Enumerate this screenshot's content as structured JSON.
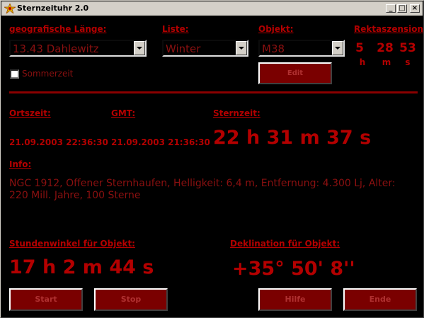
{
  "window": {
    "title": "Sternzeituhr 2.0",
    "min_label": "_",
    "max_label": "□",
    "close_label": "×"
  },
  "labels": {
    "laenge": "geografische Länge:",
    "liste": "Liste:",
    "objekt": "Objekt:",
    "rekta": "Rektaszension",
    "ortszeit": "Ortszeit:",
    "gmt": "GMT:",
    "sternzeit": "Sternzeit:",
    "info": "Info:",
    "stundenwinkel": "Stundenwinkel für Objekt:",
    "deklination": "Deklination für Objekt:"
  },
  "combos": {
    "laenge": "13.43  Dahlewitz",
    "liste": "Winter",
    "objekt": "M38"
  },
  "sommerzeit": {
    "label": "Sommerzeit",
    "checked": false
  },
  "buttons": {
    "edit": "Edit",
    "start": "Start",
    "stop": "Stop",
    "hilfe": "Hilfe",
    "ende": "Ende"
  },
  "rekta": {
    "h": "5",
    "m": "28",
    "s": "53",
    "h_unit": "h",
    "m_unit": "m",
    "s_unit": "s"
  },
  "times": {
    "ortszeit": "21.09.2003 22:36:30",
    "gmt": "21.09.2003 21:36:30",
    "sternzeit": "22 h 31 m 37 s"
  },
  "info_text": "NGC 1912, Offener Sternhaufen, Helligkeit: 6,4 m, Entfernung: 4.300 Lj, Alter: 220 Mill. Jahre, 100 Sterne",
  "stundenwinkel": "17 h 2 m 44 s",
  "deklination": "+35° 50' 8''",
  "colors": {
    "accent": "#b30000",
    "button_bg": "#7a0000",
    "background": "#000000",
    "chrome": "#d4d0c8"
  }
}
